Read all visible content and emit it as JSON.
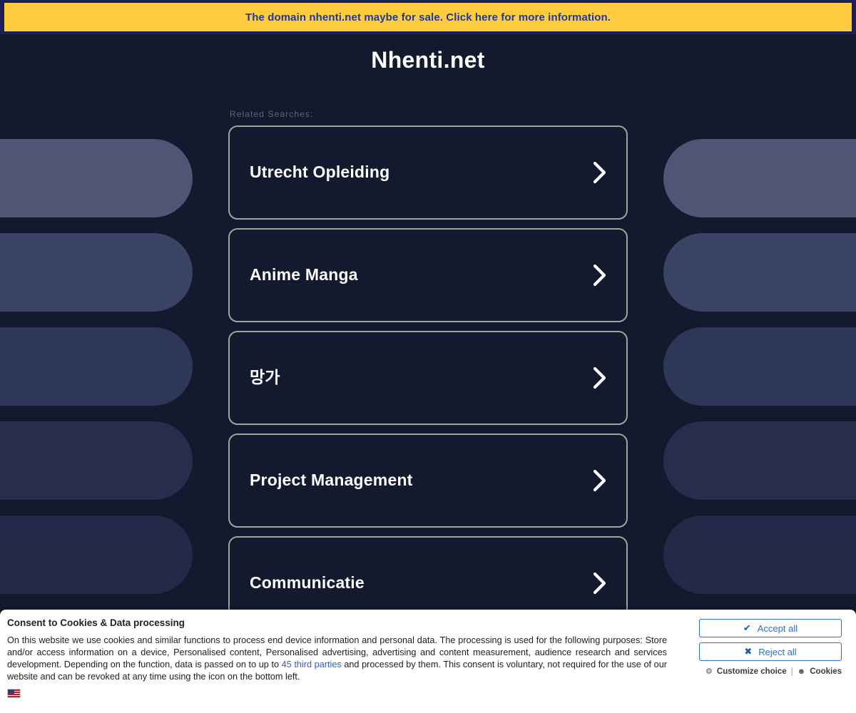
{
  "sale_banner": {
    "text": "The domain nhenti.net maybe for sale. Click here for more information.",
    "bg_color": "#ffcc3f",
    "text_color": "#1f3a93",
    "outer_color": "#1e2055"
  },
  "header": {
    "title": "Nhenti.net"
  },
  "related": {
    "label": "Related Searches:",
    "items": [
      {
        "label": "Utrecht Opleiding",
        "chevron": "chevron-right-icon"
      },
      {
        "label": "Anime Manga",
        "chevron": "chevron-right-icon"
      },
      {
        "label": "망가",
        "chevron": "chevron-right-icon"
      },
      {
        "label": "Project Management",
        "chevron": "chevron-right-icon"
      },
      {
        "label": "Communicatie",
        "chevron": "chevron-right-icon"
      }
    ]
  },
  "decor": {
    "pill_colors": [
      "#4e5575",
      "#3b4365",
      "#2f3758",
      "#272e4d",
      "#222a48"
    ],
    "page_bg": "#141a2e",
    "card_border": "#a0a0a0",
    "card_bg": "#141a2e"
  },
  "consent": {
    "title": "Consent to Cookies & Data processing",
    "body_part1": "On this website we use cookies and similar functions to process end device information and personal data. The processing is used for the following purposes: Store and/or access information on a device, Personalised content, Personalised advertising, advertising and content measurement, audience research and services development. Depending on the function, data is passed on to up to ",
    "body_link": "45 third parties",
    "body_part2": " and processed by them. This consent is voluntary, not required for the use of our website and can be revoked at any time using the icon on the bottom left.",
    "accept_label": "Accept all",
    "accept_icon": "check-icon",
    "accept_glyph": "✔",
    "reject_label": "Reject all",
    "reject_icon": "cross-icon",
    "reject_glyph": "✖",
    "customize_label": "Customize choice",
    "customize_icon": "gear-icon",
    "customize_glyph": "⚙",
    "separator": "|",
    "cookies_label": "Cookies",
    "cookies_icon": "cookie-icon",
    "cookies_glyph": "☻",
    "language_icon": "us-flag-icon",
    "link_color": "#2f5fd0",
    "button_color": "#2f6fc4"
  }
}
